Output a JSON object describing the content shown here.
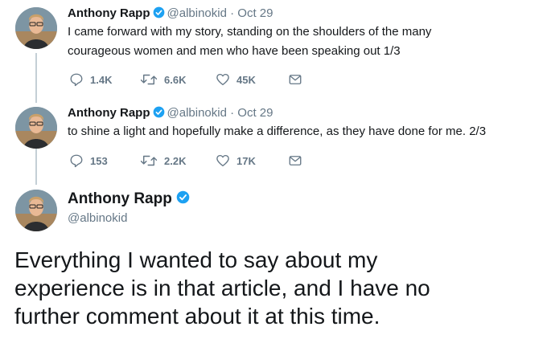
{
  "colors": {
    "verified": "#1da1f2",
    "muted": "#657786",
    "text": "#14171a",
    "thread_line": "#c4cfd6"
  },
  "tweets": [
    {
      "name": "Anthony Rapp",
      "handle": "@albinokid",
      "separator": "·",
      "date": "Oct 29",
      "lines": [
        "I came forward with my story, standing on the shoulders of the many",
        "courageous women and men who have been speaking out 1/3"
      ],
      "replies": "1.4K",
      "retweets": "6.6K",
      "likes": "45K"
    },
    {
      "name": "Anthony Rapp",
      "handle": "@albinokid",
      "separator": "·",
      "date": "Oct 29",
      "lines": [
        "to shine a light and hopefully make a difference, as they have done for me.  2/3"
      ],
      "replies": "153",
      "retweets": "2.2K",
      "likes": "17K"
    }
  ],
  "main_tweet": {
    "name": "Anthony Rapp",
    "handle": "@albinokid",
    "text_lines": [
      "Everything I wanted to say about my",
      "experience is in that article, and I have no",
      "further comment about it at this time."
    ]
  },
  "icons": [
    "reply-icon",
    "retweet-icon",
    "like-icon",
    "direct-message-icon",
    "verified-badge-icon"
  ]
}
